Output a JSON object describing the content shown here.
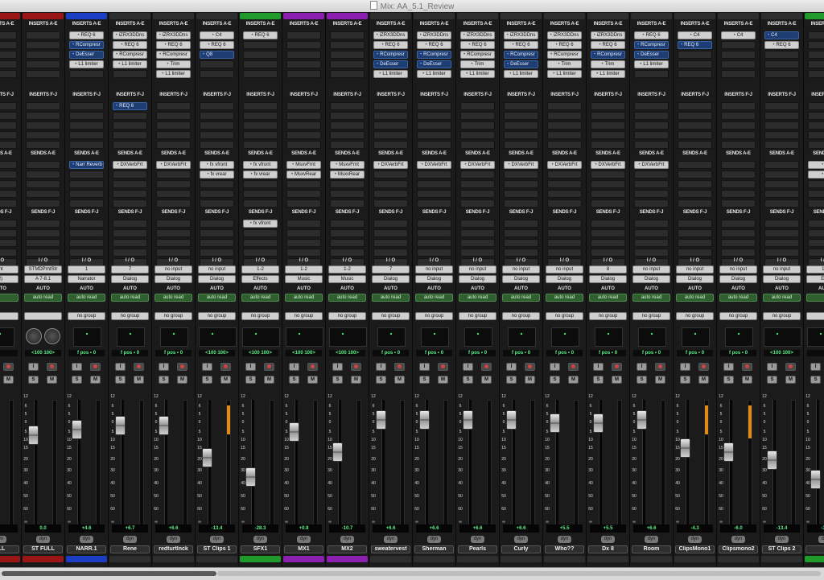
{
  "window": {
    "title": "Mix: AA_5.1_Review"
  },
  "headers": {
    "inserts_ae": "INSERTS A-E",
    "inserts_fj": "INSERTS F-J",
    "sends_ae": "SENDS A-E",
    "sends_fj": "SENDS F-J",
    "io": "I / O",
    "auto": "AUTO"
  },
  "tracks": [
    {
      "name": "ULL",
      "color": "#9a1616",
      "ins_ae": [],
      "ins_fj": [],
      "sends_ae": [],
      "sends_fj": [],
      "input": "rint",
      "output": "(2)",
      "auto": "",
      "group": "",
      "pan": "",
      "fader": 0.82,
      "meter": 0,
      "value": "",
      "stereo": false,
      "partial": true
    },
    {
      "name": "ST FULL",
      "color": "#9a1616",
      "ins_ae": [],
      "ins_fj": [],
      "sends_ae": [],
      "sends_fj": [],
      "input": "STMDPrntStr",
      "output": "A 7-8.1",
      "auto": "auto read",
      "group": "",
      "pan": "<100  100>",
      "fader": 0.23,
      "meter": 0,
      "value": "0.0",
      "stereo": true,
      "knob": true
    },
    {
      "name": "NARR.1",
      "color": "#1a3fc4",
      "ins_ae": [
        {
          "t": "REQ 6",
          "s": "f"
        },
        {
          "t": "RCompresr",
          "s": "b"
        },
        {
          "t": "DeEsser",
          "s": "b"
        },
        {
          "t": "L1 limiter",
          "s": "f"
        }
      ],
      "ins_fj": [],
      "sends_ae": [
        {
          "t": "Narr Reverb",
          "s": "b"
        }
      ],
      "sends_fj": [],
      "input": "1",
      "output": "Narrator",
      "auto": "auto read",
      "group": "no group",
      "pan": "f pos • 0",
      "fader": 0.18,
      "meter": 0,
      "value": "+4.6",
      "stereo": false
    },
    {
      "name": "Rene",
      "color": "",
      "ins_ae": [
        {
          "t": "iZRX3DDns",
          "s": "f"
        },
        {
          "t": "REQ 6",
          "s": "f"
        },
        {
          "t": "RCompresr",
          "s": "f"
        },
        {
          "t": "L1 limiter",
          "s": "f"
        }
      ],
      "ins_fj": [
        {
          "t": "REQ 6",
          "s": "b"
        }
      ],
      "sends_ae": [
        {
          "t": "DXVerbFrt",
          "s": "f"
        }
      ],
      "sends_fj": [],
      "input": "7",
      "output": "Dialog",
      "auto": "auto read",
      "group": "no group",
      "pan": "f pos • 0",
      "fader": 0.14,
      "meter": 0,
      "value": "+6.7",
      "stereo": false
    },
    {
      "name": "redturtlnck",
      "color": "",
      "ins_ae": [
        {
          "t": "iZRX3DDns",
          "s": "f"
        },
        {
          "t": "REQ 6",
          "s": "f"
        },
        {
          "t": "RCompresr",
          "s": "f"
        },
        {
          "t": "Trim",
          "s": "f"
        },
        {
          "t": "L1 limiter",
          "s": "f"
        }
      ],
      "ins_fj": [],
      "sends_ae": [
        {
          "t": "DXVerbFrt",
          "s": "f"
        }
      ],
      "sends_fj": [],
      "input": "no input",
      "output": "Dialog",
      "auto": "auto read",
      "group": "no group",
      "pan": "f pos • 0",
      "fader": 0.14,
      "meter": 0,
      "value": "+6.6",
      "stereo": false
    },
    {
      "name": "ST Clips 1",
      "color": "",
      "ins_ae": [
        {
          "t": "C4",
          "s": "f"
        },
        {
          "t": "REQ 6",
          "s": "f"
        },
        {
          "t": "Q8",
          "s": "b"
        }
      ],
      "ins_fj": [],
      "sends_ae": [
        {
          "t": "fx vfront",
          "s": "f"
        },
        {
          "t": "fx vrear",
          "s": "f"
        }
      ],
      "sends_fj": [],
      "input": "no input",
      "output": "Dialog",
      "auto": "auto read",
      "group": "no group",
      "pan": "<100  100>",
      "fader": 0.43,
      "meter": 0.22,
      "value": "-13.4",
      "stereo": true
    },
    {
      "name": "SFX1",
      "color": "#1f9a2b",
      "ins_ae": [
        {
          "t": "REQ 6",
          "s": "f"
        }
      ],
      "ins_fj": [],
      "sends_ae": [
        {
          "t": "fx vfront",
          "s": "f"
        },
        {
          "t": "fx vrear",
          "s": "f"
        }
      ],
      "sends_fj": [
        {
          "t": "fx vfront",
          "s": "f"
        }
      ],
      "input": "1-2",
      "output": "Effects",
      "auto": "auto read",
      "group": "no group",
      "pan": "<100  100>",
      "fader": 0.6,
      "meter": 0,
      "value": "-28.3",
      "stereo": true
    },
    {
      "name": "MX1",
      "color": "#8a1fb0",
      "ins_ae": [],
      "ins_fj": [],
      "sends_ae": [
        {
          "t": "MsxvFrnt",
          "s": "f"
        },
        {
          "t": "MsxvRear",
          "s": "f"
        }
      ],
      "sends_fj": [],
      "input": "1-2",
      "output": "Music",
      "auto": "auto read",
      "group": "no group",
      "pan": "<100  100>",
      "fader": 0.2,
      "meter": 0,
      "value": "+0.8",
      "stereo": true
    },
    {
      "name": "MX2",
      "color": "#8a1fb0",
      "ins_ae": [],
      "ins_fj": [],
      "sends_ae": [
        {
          "t": "MsxvFrnt",
          "s": "f"
        },
        {
          "t": "MsxvRear",
          "s": "f"
        }
      ],
      "sends_fj": [],
      "input": "1-2",
      "output": "Music",
      "auto": "auto read",
      "group": "no group",
      "pan": "<100  100>",
      "fader": 0.38,
      "meter": 0,
      "value": "-10.7",
      "stereo": true
    },
    {
      "name": "sweatervest",
      "color": "",
      "ins_ae": [
        {
          "t": "iZRX3DDns",
          "s": "f"
        },
        {
          "t": "REQ 6",
          "s": "f"
        },
        {
          "t": "RCompresr",
          "s": "b"
        },
        {
          "t": "DeEsser",
          "s": "b"
        },
        {
          "t": "L1 limiter",
          "s": "f"
        }
      ],
      "ins_fj": [],
      "sends_ae": [
        {
          "t": "DXVerbFrt",
          "s": "f"
        }
      ],
      "sends_fj": [],
      "input": "7",
      "output": "Dialog",
      "auto": "auto read",
      "group": "no group",
      "pan": "f pos • 0",
      "fader": 0.09,
      "meter": 0,
      "value": "+6.6",
      "stereo": false
    },
    {
      "name": "Sherman",
      "color": "",
      "ins_ae": [
        {
          "t": "iZRX3DDns",
          "s": "f"
        },
        {
          "t": "REQ 6",
          "s": "f"
        },
        {
          "t": "RCompresr",
          "s": "b"
        },
        {
          "t": "DeEsser",
          "s": "b"
        },
        {
          "t": "L1 limiter",
          "s": "f"
        }
      ],
      "ins_fj": [],
      "sends_ae": [
        {
          "t": "DXVerbFrt",
          "s": "f"
        }
      ],
      "sends_fj": [],
      "input": "no input",
      "output": "Dialog",
      "auto": "auto read",
      "group": "no group",
      "pan": "f pos • 0",
      "fader": 0.09,
      "meter": 0,
      "value": "+6.6",
      "stereo": false
    },
    {
      "name": "Pearls",
      "color": "",
      "ins_ae": [
        {
          "t": "iZRX3DDns",
          "s": "f"
        },
        {
          "t": "REQ 6",
          "s": "f"
        },
        {
          "t": "RCompresr",
          "s": "f"
        },
        {
          "t": "Trim",
          "s": "f"
        },
        {
          "t": "L1 limiter",
          "s": "f"
        }
      ],
      "ins_fj": [],
      "sends_ae": [
        {
          "t": "DXVerbFrt",
          "s": "f"
        }
      ],
      "sends_fj": [],
      "input": "no input",
      "output": "Dialog",
      "auto": "auto read",
      "group": "no group",
      "pan": "f pos • 0",
      "fader": 0.09,
      "meter": 0,
      "value": "+6.6",
      "stereo": false
    },
    {
      "name": "Curly",
      "color": "",
      "ins_ae": [
        {
          "t": "iZRX3DDns",
          "s": "f"
        },
        {
          "t": "REQ 6",
          "s": "f"
        },
        {
          "t": "RCompresr",
          "s": "b"
        },
        {
          "t": "DeEsser",
          "s": "b"
        },
        {
          "t": "L1 limiter",
          "s": "f"
        }
      ],
      "ins_fj": [],
      "sends_ae": [
        {
          "t": "DXVerbFrt",
          "s": "f"
        }
      ],
      "sends_fj": [],
      "input": "no input",
      "output": "Dialog",
      "auto": "auto read",
      "group": "no group",
      "pan": "f pos • 0",
      "fader": 0.09,
      "meter": 0,
      "value": "+6.6",
      "stereo": false
    },
    {
      "name": "Who??",
      "color": "",
      "ins_ae": [
        {
          "t": "iZRX3DDns",
          "s": "f"
        },
        {
          "t": "REQ 6",
          "s": "f"
        },
        {
          "t": "RCompresr",
          "s": "f"
        },
        {
          "t": "Trim",
          "s": "f"
        },
        {
          "t": "L1 limiter",
          "s": "f"
        }
      ],
      "ins_fj": [],
      "sends_ae": [
        {
          "t": "DXVerbFrt",
          "s": "f"
        }
      ],
      "sends_fj": [],
      "input": "no input",
      "output": "Dialog",
      "auto": "auto read",
      "group": "no group",
      "pan": "f pos • 0",
      "fader": 0.12,
      "meter": 0,
      "value": "+5.5",
      "stereo": false
    },
    {
      "name": "Dx 8",
      "color": "",
      "ins_ae": [
        {
          "t": "iZRX3DDns",
          "s": "f"
        },
        {
          "t": "REQ 6",
          "s": "f"
        },
        {
          "t": "RCompresr",
          "s": "b"
        },
        {
          "t": "Trim",
          "s": "f"
        },
        {
          "t": "L1 limiter",
          "s": "f"
        }
      ],
      "ins_fj": [],
      "sends_ae": [
        {
          "t": "DXVerbFrt",
          "s": "f"
        }
      ],
      "sends_fj": [],
      "input": "8",
      "output": "Dialog",
      "auto": "auto read",
      "group": "no group",
      "pan": "f pos • 0",
      "fader": 0.12,
      "meter": 0,
      "value": "+5.5",
      "stereo": false
    },
    {
      "name": "Room",
      "color": "",
      "ins_ae": [
        {
          "t": "REQ 6",
          "s": "f"
        },
        {
          "t": "RCompresr",
          "s": "b"
        },
        {
          "t": "DeEsser",
          "s": "b"
        },
        {
          "t": "L1 limiter",
          "s": "f"
        }
      ],
      "ins_fj": [],
      "sends_ae": [
        {
          "t": "DXVerbFrt",
          "s": "f"
        }
      ],
      "sends_fj": [],
      "input": "no input",
      "output": "Dialog",
      "auto": "auto read",
      "group": "no group",
      "pan": "f pos • 0",
      "fader": 0.09,
      "meter": 0,
      "value": "+6.6",
      "stereo": false
    },
    {
      "name": "ClipsMono1",
      "color": "",
      "ins_ae": [
        {
          "t": "C4",
          "s": "f"
        },
        {
          "t": "REQ 6",
          "s": "b"
        }
      ],
      "ins_fj": [],
      "sends_ae": [],
      "sends_fj": [],
      "input": "no input",
      "output": "Dialog",
      "auto": "auto read",
      "group": "no group",
      "pan": "f pos • 0",
      "fader": 0.34,
      "meter": 0.22,
      "value": "-4.3",
      "stereo": false
    },
    {
      "name": "Clipsmono2",
      "color": "",
      "ins_ae": [
        {
          "t": "C4",
          "s": "f"
        }
      ],
      "ins_fj": [],
      "sends_ae": [],
      "sends_fj": [],
      "input": "no input",
      "output": "Dialog",
      "auto": "auto read",
      "group": "no group",
      "pan": "f pos • 0",
      "fader": 0.38,
      "meter": 0.25,
      "value": "-6.0",
      "stereo": false
    },
    {
      "name": "ST Clips 2",
      "color": "",
      "ins_ae": [
        {
          "t": "C4",
          "s": "b"
        },
        {
          "t": "REQ 6",
          "s": "f"
        }
      ],
      "ins_fj": [],
      "sends_ae": [],
      "sends_fj": [],
      "input": "no input",
      "output": "Dialog",
      "auto": "auto read",
      "group": "no group",
      "pan": "<100  100>",
      "fader": 0.45,
      "meter": 0,
      "value": "-13.4",
      "stereo": true
    },
    {
      "name": "",
      "color": "#1f9a2b",
      "ins_ae": [],
      "ins_fj": [],
      "sends_ae": [
        {
          "t": "fx",
          "s": "f"
        },
        {
          "t": "fx",
          "s": "f"
        }
      ],
      "sends_fj": [],
      "input": "1-2",
      "output": "Effe",
      "auto": "",
      "group": "",
      "pan": "",
      "fader": 0.62,
      "meter": 0,
      "value": "-30.",
      "stereo": true,
      "partial": true
    }
  ],
  "scale_marks": [
    "12",
    "6",
    "5",
    "0",
    "5",
    "10",
    "15",
    "20",
    "30",
    "40",
    "50",
    "60",
    "∞"
  ],
  "icons": {
    "solo": "S",
    "mute": "M",
    "input_mon": "I",
    "record": "record-icon",
    "dyn": "dyn"
  }
}
